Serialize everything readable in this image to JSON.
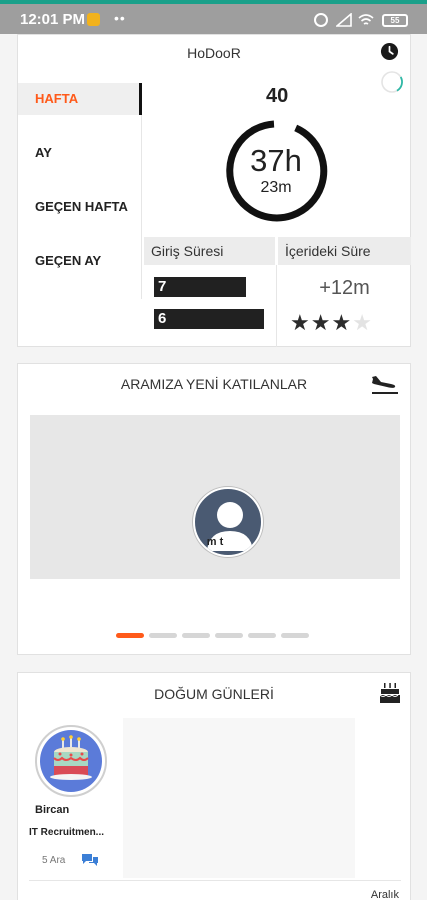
{
  "status_bar": {
    "time": "12:01 PM",
    "dots": "••",
    "battery": "55"
  },
  "summary_card": {
    "title": "HoDooR",
    "periods": [
      "HAFTA",
      "AY",
      "GEÇEN HAFTA",
      "GEÇEN AY"
    ],
    "active_period": "HAFTA",
    "count": "40",
    "hours": "37h",
    "minutes": "23m",
    "login_duration_label": "Giriş Süresi",
    "inside_duration_label": "İçerideki Süre",
    "bar_values": [
      "7",
      "6"
    ],
    "delta": "+12m",
    "rating": 3,
    "rating_max": 4,
    "accent_color": "#ff5a1a"
  },
  "new_members_card": {
    "title": "ARAMIZA YENİ KATILANLAR",
    "member_name": "m t",
    "page_count": 6,
    "active_page": 1
  },
  "birthdays_card": {
    "title": "DOĞUM GÜNLERİ",
    "person": {
      "name": "Bircan",
      "role": "IT Recruitmen...",
      "date": "5 Ara"
    },
    "month_label": "Aralık"
  },
  "icons": [
    "clock-icon",
    "progress-ring-icon",
    "airplane-landing-icon",
    "cake-icon",
    "chat-icon",
    "user-avatar-icon"
  ]
}
